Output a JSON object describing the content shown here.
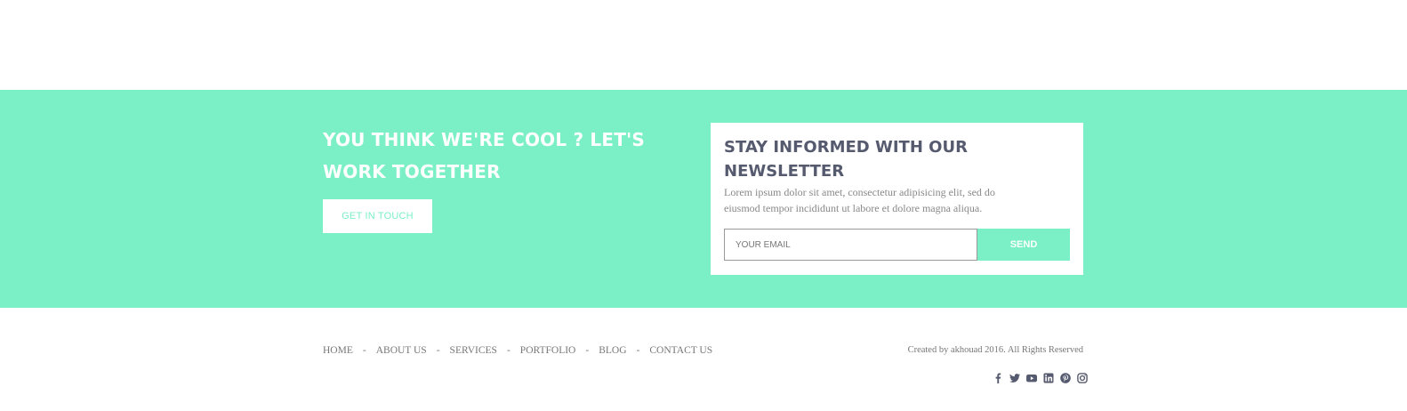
{
  "cta": {
    "title": "YOU THINK WE'RE COOL ? LET'S WORK TOGETHER",
    "button_label": "GET IN TOUCH"
  },
  "newsletter": {
    "title": "STAY INFORMED WITH OUR NEWSLETTER",
    "description": "Lorem ipsum dolor sit amet, consectetur adipisicing elit, sed do eiusmod tempor incididunt ut labore et dolore magna aliqua.",
    "email_placeholder": "YOUR EMAIL",
    "send_label": "SEND"
  },
  "footer": {
    "nav": [
      {
        "label": "HOME"
      },
      {
        "label": "ABOUT US"
      },
      {
        "label": "SERVICES"
      },
      {
        "label": "PORTFOLIO"
      },
      {
        "label": "BLOG"
      },
      {
        "label": "CONTACT US"
      }
    ],
    "separator": "-",
    "copyright": "Created by akhouad 2016. All Rights Reserved",
    "social": [
      "facebook-icon",
      "twitter-icon",
      "youtube-icon",
      "linkedin-icon",
      "pinterest-icon",
      "instagram-icon"
    ]
  },
  "colors": {
    "accent": "#7befc6",
    "heading": "#565a6e",
    "muted_text": "#777777"
  }
}
